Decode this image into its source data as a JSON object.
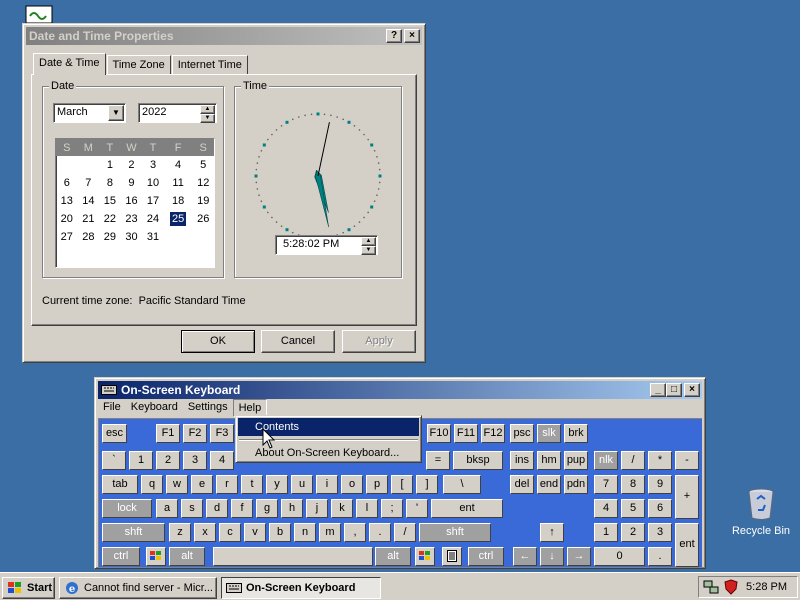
{
  "datetime": {
    "title": "Date and Time Properties",
    "help_btn": "?",
    "close_btn": "×",
    "tabs": [
      "Date & Time",
      "Time Zone",
      "Internet Time"
    ],
    "date_group": "Date",
    "time_group": "Time",
    "month": "March",
    "year": "2022",
    "weekdays": [
      "S",
      "M",
      "T",
      "W",
      "T",
      "F",
      "S"
    ],
    "weeks": [
      [
        "",
        "",
        "1",
        "2",
        "3",
        "4",
        "5"
      ],
      [
        "6",
        "7",
        "8",
        "9",
        "10",
        "11",
        "12"
      ],
      [
        "13",
        "14",
        "15",
        "16",
        "17",
        "18",
        "19"
      ],
      [
        "20",
        "21",
        "22",
        "23",
        "24",
        "25",
        "26"
      ],
      [
        "27",
        "28",
        "29",
        "30",
        "31",
        "",
        ""
      ]
    ],
    "selected_day": "25",
    "time_value": "5:28:02 PM",
    "timezone_text": "Current time zone:  Pacific Standard Time",
    "ok": "OK",
    "cancel": "Cancel",
    "apply": "Apply",
    "clock": {
      "hour": 5,
      "minute": 28,
      "second": 2
    }
  },
  "osk": {
    "title": "On-Screen Keyboard",
    "menus": [
      "File",
      "Keyboard",
      "Settings",
      "Help"
    ],
    "help_menu": [
      "Contents",
      "About On-Screen Keyboard..."
    ],
    "keys": {
      "row0": [
        "esc",
        "F1",
        "F2",
        "F3",
        "F10",
        "F11",
        "F12",
        "psc",
        "slk",
        "brk"
      ],
      "row1": [
        "`",
        "1",
        "2",
        "3",
        "4",
        "=",
        "bksp",
        "ins",
        "hm",
        "pup",
        "nlk",
        "/",
        "*",
        "-"
      ],
      "row2": [
        "tab",
        "q",
        "w",
        "e",
        "r",
        "t",
        "y",
        "u",
        "i",
        "o",
        "p",
        "[",
        "]",
        "\\",
        "del",
        "end",
        "pdn",
        "7",
        "8",
        "9",
        "+"
      ],
      "row3": [
        "lock",
        "a",
        "s",
        "d",
        "f",
        "g",
        "h",
        "j",
        "k",
        "l",
        ";",
        "'",
        "ent",
        "4",
        "5",
        "6"
      ],
      "row4": [
        "shft",
        "z",
        "x",
        "c",
        "v",
        "b",
        "n",
        "m",
        ",",
        ".",
        "/",
        "shft",
        "↑",
        "1",
        "2",
        "3",
        "ent"
      ],
      "row5": [
        "ctrl",
        "alt",
        "alt",
        "ctrl",
        "←",
        "↓",
        "→",
        "0",
        "."
      ]
    }
  },
  "desktop": {
    "recycle_bin": "Recycle Bin"
  },
  "taskbar": {
    "start": "Start",
    "items": [
      "Cannot find server - Micr...",
      "On-Screen Keyboard"
    ],
    "clock": "5:28 PM"
  },
  "colors": {
    "desktop": "#3a6ea5",
    "active_title": "#0a246a",
    "keyboard_bg": "#3a6ad8"
  }
}
